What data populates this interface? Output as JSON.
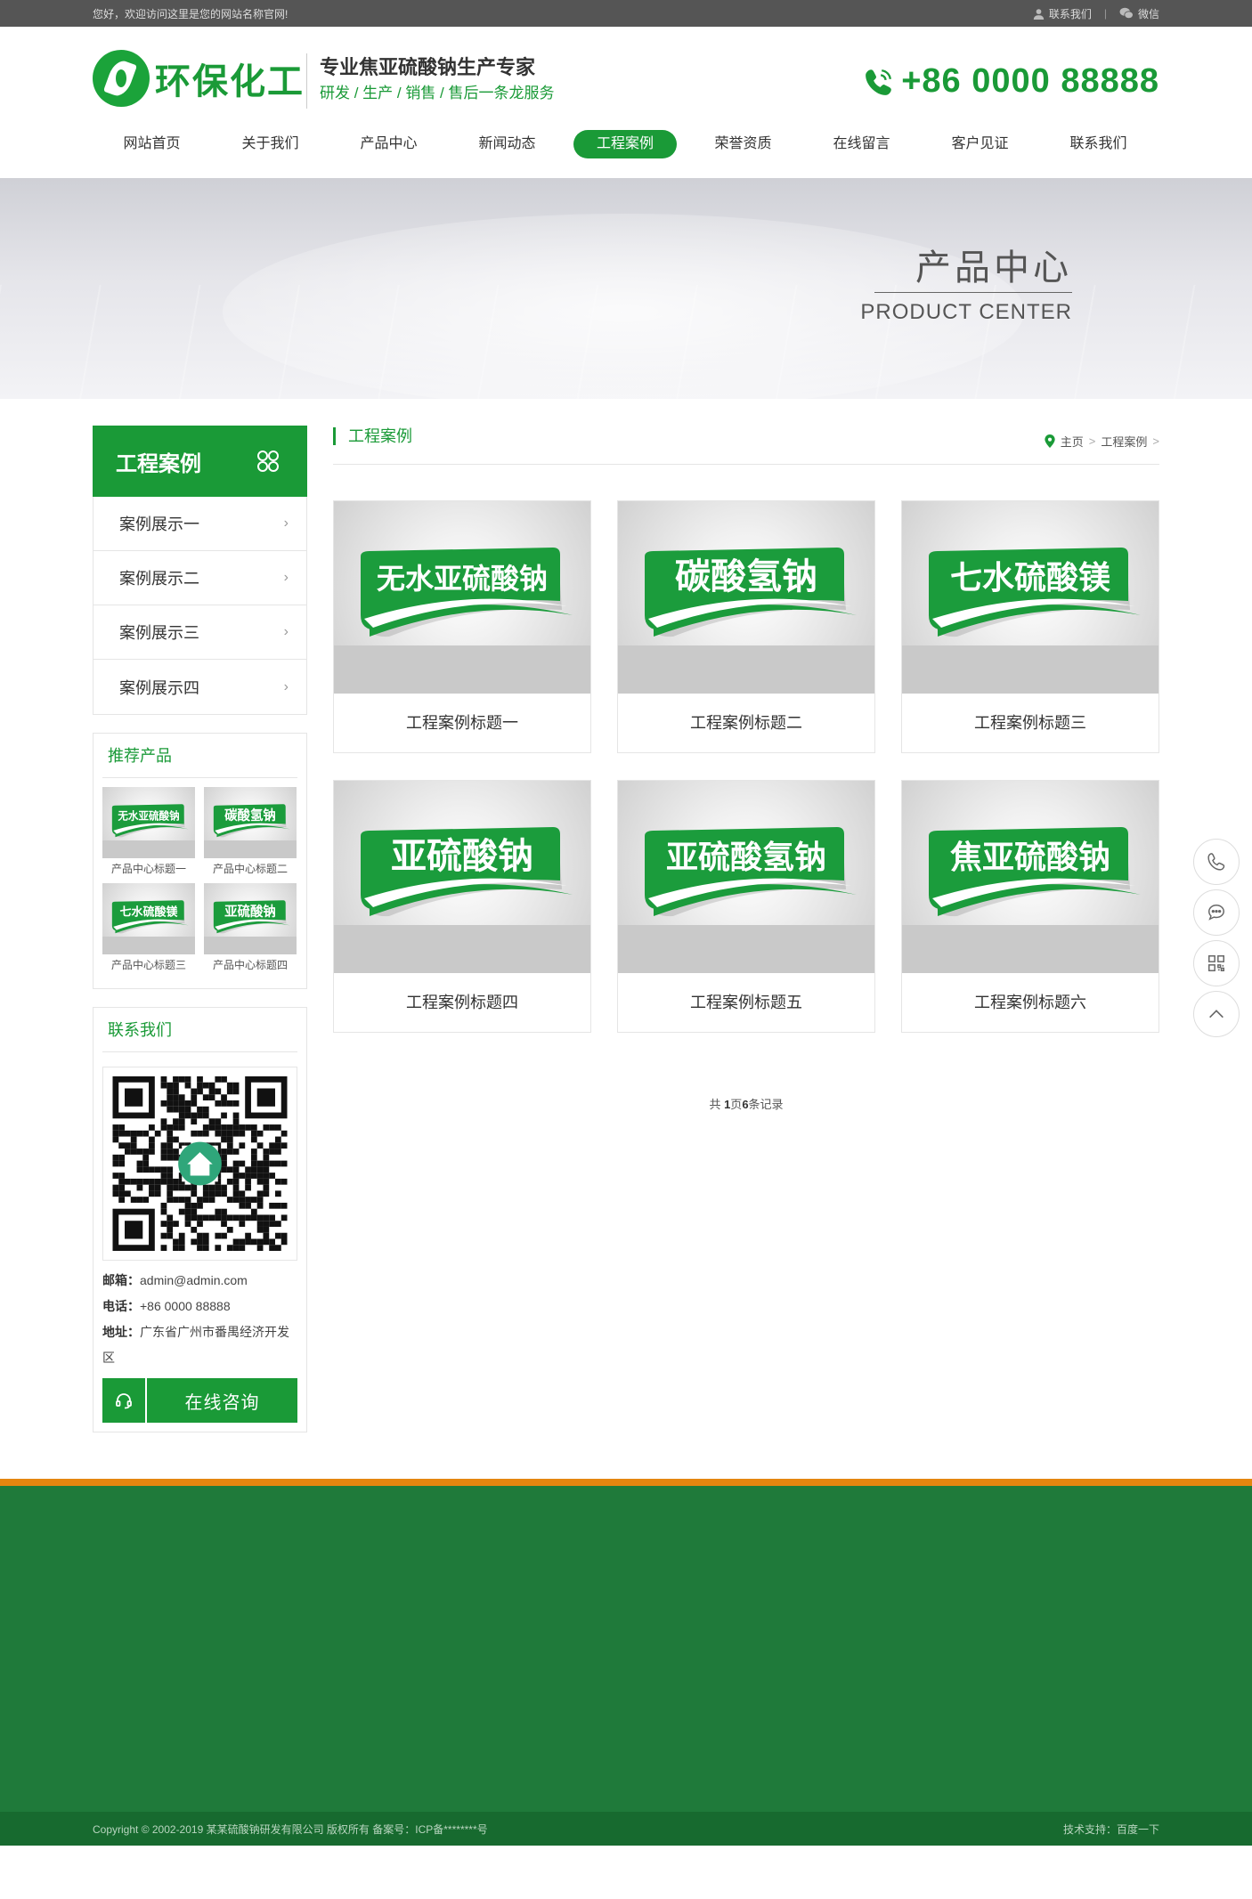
{
  "topbar": {
    "welcome": "您好，欢迎访问这里是您的网站名称官网!",
    "contact_label": "联系我们",
    "wechat_label": "微信"
  },
  "header": {
    "logo_text": "环保化工",
    "slogan_title": "专业焦亚硫酸钠生产专家",
    "slogan_sub": "研发 / 生产 / 销售 / 售后一条龙服务",
    "phone": "+86 0000 88888"
  },
  "nav": {
    "items": [
      {
        "label": "网站首页"
      },
      {
        "label": "关于我们"
      },
      {
        "label": "产品中心"
      },
      {
        "label": "新闻动态"
      },
      {
        "label": "工程案例",
        "active": true
      },
      {
        "label": "荣誉资质"
      },
      {
        "label": "在线留言"
      },
      {
        "label": "客户见证"
      },
      {
        "label": "联系我们"
      }
    ]
  },
  "banner": {
    "title_cn": "产品中心",
    "title_en": "PRODUCT CENTER"
  },
  "sidebar": {
    "title": "工程案例",
    "items": [
      {
        "label": "案例展示一"
      },
      {
        "label": "案例展示二"
      },
      {
        "label": "案例展示三"
      },
      {
        "label": "案例展示四"
      }
    ],
    "recommend_title": "推荐产品",
    "recommend": [
      {
        "badge": "无水亚硫酸钠",
        "caption": "产品中心标题一"
      },
      {
        "badge": "碳酸氢钠",
        "caption": "产品中心标题二"
      },
      {
        "badge": "七水硫酸镁",
        "caption": "产品中心标题三"
      },
      {
        "badge": "亚硫酸钠",
        "caption": "产品中心标题四"
      }
    ],
    "contact_title": "联系我们",
    "email_label": "邮箱：",
    "email": "admin@admin.com",
    "phone_label": "电话：",
    "phone": "+86 0000 88888",
    "address_label": "地址：",
    "address": "广东省广州市番禺经济开发区",
    "consult_label": "在线咨询"
  },
  "content": {
    "section_title": "工程案例",
    "breadcrumb": {
      "home": "主页",
      "current": "工程案例"
    },
    "cases": [
      {
        "badge": "无水亚硫酸钠",
        "caption": "工程案例标题一"
      },
      {
        "badge": "碳酸氢钠",
        "caption": "工程案例标题二"
      },
      {
        "badge": "七水硫酸镁",
        "caption": "工程案例标题三"
      },
      {
        "badge": "亚硫酸钠",
        "caption": "工程案例标题四"
      },
      {
        "badge": "亚硫酸氢钠",
        "caption": "工程案例标题五"
      },
      {
        "badge": "焦亚硫酸钠",
        "caption": "工程案例标题六"
      }
    ],
    "pager": {
      "pre": "共 ",
      "pages": "1",
      "mid": "页",
      "records": "6",
      "post": "条记录"
    }
  },
  "footer": {
    "copyright": "Copyright © 2002-2019 某某硫酸钠研发有限公司 版权所有   备案号：ICP备********号",
    "support": "技术支持：百度一下"
  },
  "colors": {
    "brand": "#1a9a37",
    "footer_bg": "#1f7a3a",
    "footer_accent": "#e4860f",
    "topbar_bg": "#555555"
  }
}
